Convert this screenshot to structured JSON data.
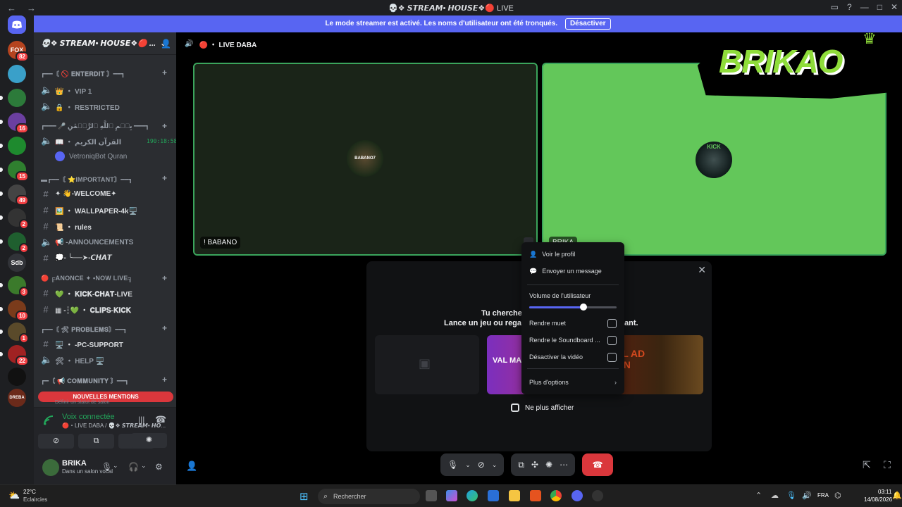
{
  "window": {
    "title": "💀❖ 𝙎𝙏𝙍𝙀𝘼𝙈• 𝙃𝙊𝙐𝙎𝙀❖🔴 LIVE",
    "back": "←",
    "forward": "→"
  },
  "streamer_banner": {
    "text": "Le mode streamer est activé. Les noms d'utilisateur ont été tronqués.",
    "button": "Désactiver"
  },
  "servers": [
    {
      "label": "FOX",
      "badge": "82",
      "color": "#b5441f"
    },
    {
      "label": "",
      "badge": "",
      "color": "#3aa0c9"
    },
    {
      "label": "",
      "badge": "",
      "color": "#2c7a3a"
    },
    {
      "label": "",
      "badge": "16",
      "color": "#6b3fa0"
    },
    {
      "label": "",
      "badge": "",
      "color": "#1e8a2e"
    },
    {
      "label": "",
      "badge": "15",
      "color": "#2f7f2f"
    },
    {
      "label": "",
      "badge": "49",
      "color": "#444"
    },
    {
      "label": "",
      "badge": "2",
      "color": "#333"
    },
    {
      "label": "",
      "badge": "2",
      "color": "#1f5f2f"
    },
    {
      "label": "Sdb",
      "badge": "",
      "color": "#313338"
    },
    {
      "label": "",
      "badge": "3",
      "color": "#3b7a2b"
    },
    {
      "label": "",
      "badge": "10",
      "color": "#7a3b1b"
    },
    {
      "label": "",
      "badge": "1",
      "color": "#5a4a2a"
    },
    {
      "label": "",
      "badge": "22",
      "color": "#a02222"
    },
    {
      "label": "",
      "badge": "",
      "color": "#111"
    },
    {
      "label": "DREBA",
      "badge": "",
      "color": "#6b2a1a"
    }
  ],
  "sidebar": {
    "server_name": "💀❖ 𝙎𝙏𝙍𝙀𝘼𝙈• 𝙃𝙊𝙐𝙎𝙀❖🔴 ...",
    "categories": [
      {
        "label": "┏━━〘 🚫 𝐄𝐍𝐓𝐄𝐑𝐃𝐈𝐓 〙━━┓",
        "channels": [
          {
            "type": "voice",
            "label": "👑 ・ VIP 1"
          },
          {
            "type": "voice",
            "label": "🔒 ・ RESTRICTED"
          }
        ]
      },
      {
        "label": "┏━━━ 🎤 بِسۡمِ ٱللَّهِ ٱلرَّحۡمَٰنِ ━━━┓",
        "channels": [
          {
            "type": "voice",
            "label": "📖 ・ القرآن الكريم",
            "timer": "190:18:58"
          },
          {
            "type": "member",
            "label": "VetroniqBot Quran"
          }
        ]
      },
      {
        "label": "▬┏━━〘 ⭐IMPORTANT〙━━┓",
        "channels": [
          {
            "type": "text",
            "label": "✦ 👋-WELCOME✦"
          },
          {
            "type": "text",
            "label": "🖼️ ・ WALLPAPER-4k🖥️"
          },
          {
            "type": "text",
            "label": "📜 ・ rules"
          },
          {
            "type": "voice",
            "label": "📢 -ANNOUNCEMENTS"
          },
          {
            "type": "text",
            "label": "💭- ╰──➤-𝘾𝙃𝘼𝙏"
          }
        ]
      },
      {
        "label": "🔴 ╔ANONCE ✦ •NOW LIVE╗",
        "channels": [
          {
            "type": "text",
            "label": "💚 ・ 𝐊𝐈𝐂𝐊-𝐂𝐇𝐀𝐓-LIVE"
          },
          {
            "type": "text",
            "label": "▦ -┆💚 ・ 𝐂𝐋𝐈𝐏𝐒-𝐊𝐈𝐂𝐊"
          }
        ]
      },
      {
        "label": "┏━━〘 🛠 𝐏𝐑𝐎𝐁𝐋𝐄𝐌𝐒〙━━┓",
        "channels": [
          {
            "type": "text",
            "label": "🖥️ ・ -PC-SUPPORT"
          },
          {
            "type": "voice",
            "label": "🛠 ・ HELP 🖥️"
          }
        ]
      },
      {
        "label": "┏━〘 📢 𝐂𝐎𝐌𝐌𝐔𝐍𝐈𝐓𝐘 〙━━┓",
        "channels": []
      }
    ],
    "mentions_label": "NOUVELLES MENTIONS",
    "mentions_sub": "Définir un statut de salon"
  },
  "voice_panel": {
    "status": "Voix connectée",
    "channel": "🔴・LIVE DABA / 💀❖ 𝙎𝙏𝙍𝙀𝘼𝙈• 𝙃𝙊..."
  },
  "user_panel": {
    "name": "BRIKA",
    "status": "Dans un salon vocal"
  },
  "call": {
    "channel_label": "🔴 ・ LIVE DABA",
    "tiles": [
      {
        "name": "! BABANO",
        "avatar_text": "BABANO7",
        "bg": "#1a2418",
        "border": "#3ba55c"
      },
      {
        "name": "BRIKA",
        "avatar_text": "KICK",
        "bg": "#63c75a",
        "border": "#3ba55c"
      }
    ],
    "overlay_logo": "BRIKAO"
  },
  "activity": {
    "line1": "Tu cherches",
    "line1_end": "",
    "line2": "Lance un jeu ou regarde",
    "line2_end": "ant.",
    "dont_show": "Ne plus afficher",
    "close": "✕",
    "games": [
      {
        "label": "",
        "color": "#1a1b1e"
      },
      {
        "label": "VAL MAS",
        "color": "#5b2a8a"
      },
      {
        "label": "VIL AD ION",
        "color": "#3a2510"
      }
    ]
  },
  "context_menu": {
    "items": [
      {
        "label": "Voir le profil",
        "icon": "user-icon"
      },
      {
        "label": "Envoyer un message",
        "icon": "chat-bubble-icon"
      }
    ],
    "volume_label": "Volume de l'utilisateur",
    "volume_value": 0.62,
    "toggles": [
      {
        "label": "Rendre muet",
        "checked": false
      },
      {
        "label": "Rendre le Soundboard ...",
        "checked": false
      },
      {
        "label": "Désactiver la vidéo",
        "checked": false
      }
    ],
    "more": "Plus d'options"
  },
  "taskbar": {
    "weather_temp": "22°C",
    "weather_desc": "Eclaircies",
    "search": "Rechercher",
    "lang": "FRA",
    "time": "03:11",
    "date": "14/08/2026"
  },
  "colors": {
    "accent": "#5865f2",
    "danger": "#da373c",
    "online": "#23a55a",
    "green_tile": "#63c75a"
  }
}
